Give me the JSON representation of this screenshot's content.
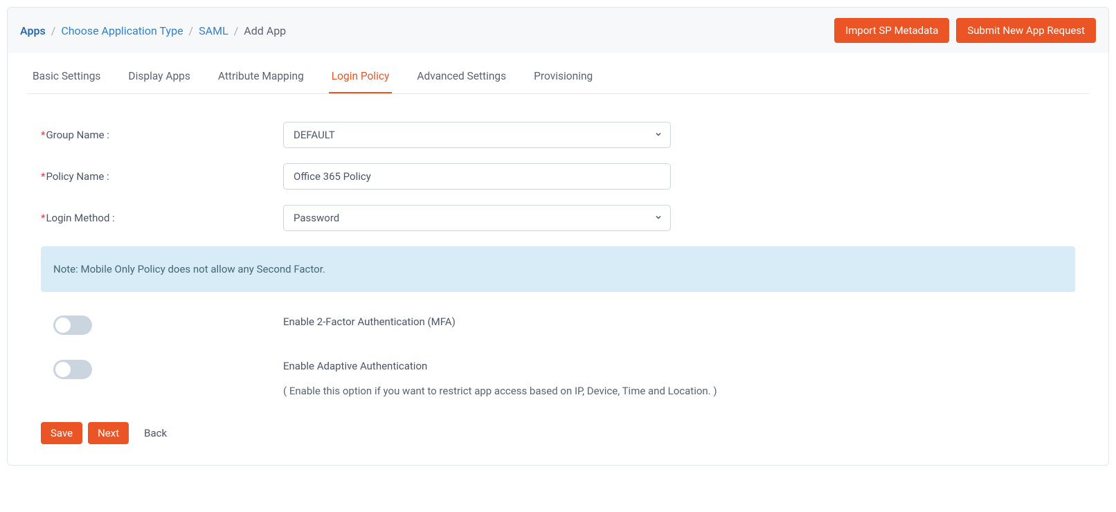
{
  "breadcrumb": {
    "items": [
      {
        "label": "Apps"
      },
      {
        "label": "Choose Application Type"
      },
      {
        "label": "SAML"
      }
    ],
    "current": "Add App",
    "sep": "/"
  },
  "header": {
    "import_btn": "Import SP Metadata",
    "submit_btn": "Submit New App Request"
  },
  "tabs": [
    {
      "label": "Basic Settings",
      "active": false
    },
    {
      "label": "Display Apps",
      "active": false
    },
    {
      "label": "Attribute Mapping",
      "active": false
    },
    {
      "label": "Login Policy",
      "active": true
    },
    {
      "label": "Advanced Settings",
      "active": false
    },
    {
      "label": "Provisioning",
      "active": false
    }
  ],
  "form": {
    "group_name": {
      "label": "Group Name :",
      "value": "DEFAULT"
    },
    "policy_name": {
      "label": "Policy Name :",
      "value": "Office 365 Policy"
    },
    "login_method": {
      "label": "Login Method :",
      "value": "Password"
    }
  },
  "alert": {
    "text": "Note: Mobile Only Policy does not allow any Second Factor."
  },
  "toggles": {
    "mfa": {
      "label": "Enable 2-Factor Authentication (MFA)",
      "on": false
    },
    "adaptive": {
      "label": "Enable Adaptive Authentication",
      "sub": "( Enable this option if you want to restrict app access based on IP, Device, Time and Location. )",
      "on": false
    }
  },
  "footer": {
    "save": "Save",
    "next": "Next",
    "back": "Back"
  }
}
